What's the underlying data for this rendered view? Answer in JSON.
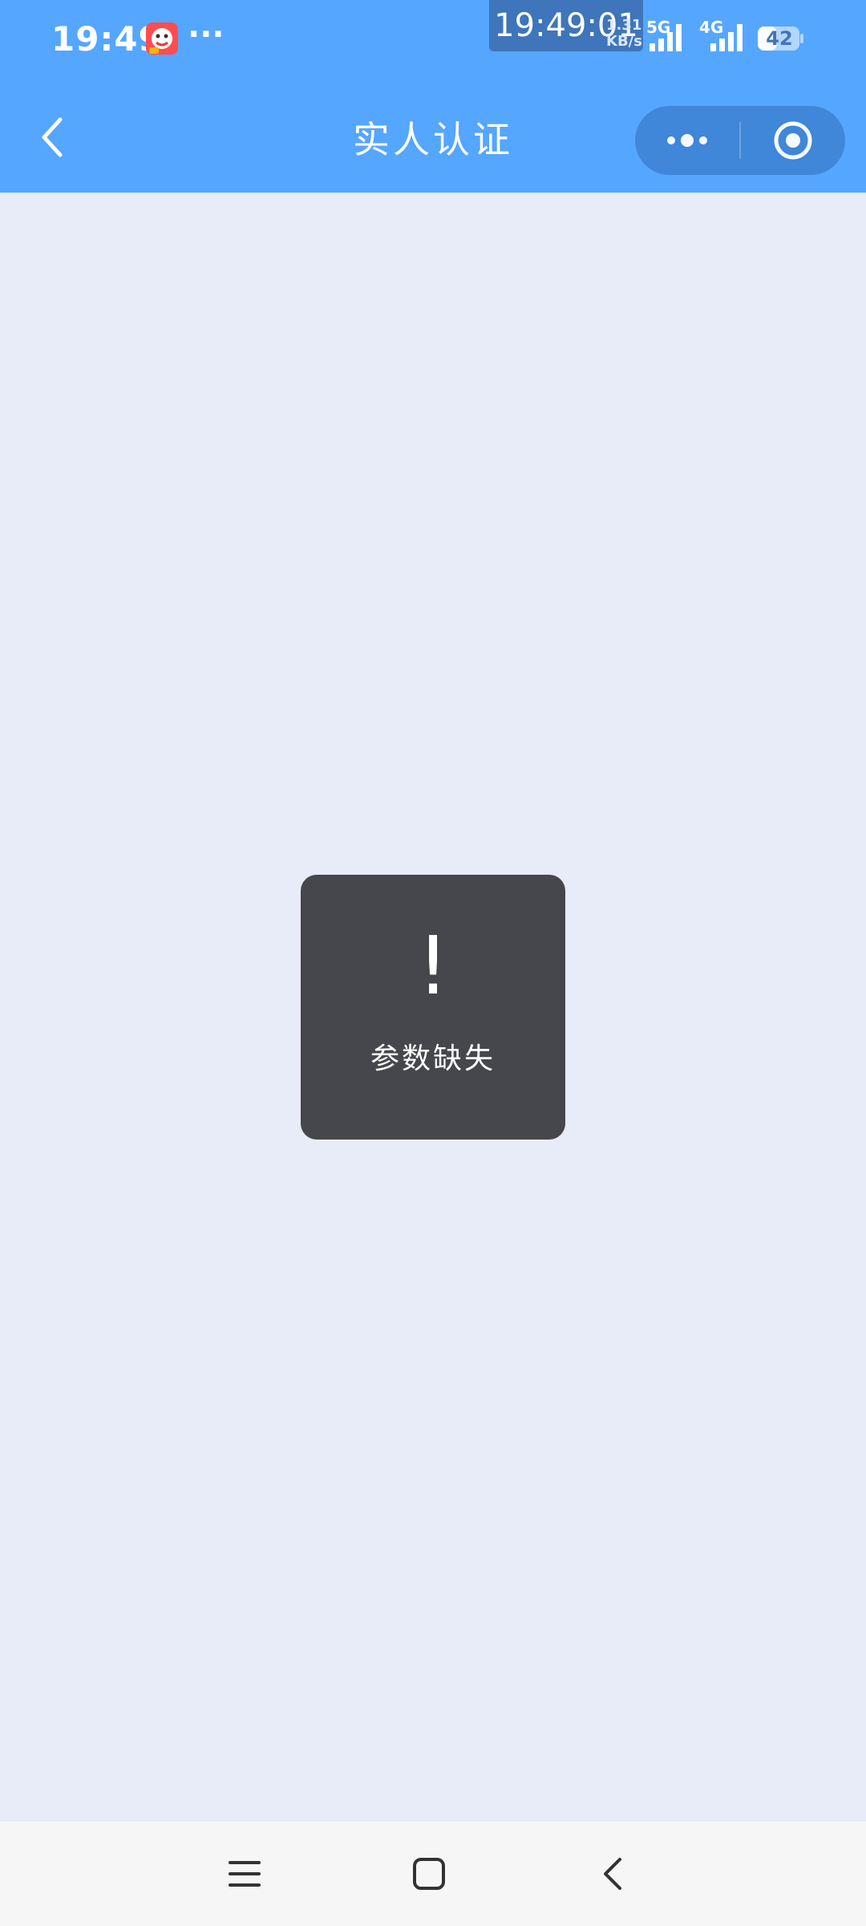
{
  "status_bar": {
    "time": "19:49",
    "app_icon": "red-mascot-icon",
    "dots": "···",
    "clock_overlay": "19:49:01",
    "speed_value": "1.31",
    "speed_unit": "KB/s",
    "network_1": "5G",
    "network_2": "4G",
    "battery_level": "42",
    "colors": {
      "background": "#55a6ff",
      "overlay": "#3f75ba"
    }
  },
  "nav": {
    "back_icon": "chevron-left-icon",
    "title": "实人认证",
    "more_icon": "more-dots-icon",
    "close_icon": "target-close-icon"
  },
  "toast": {
    "icon": "!",
    "message": "参数缺失"
  },
  "system_nav": {
    "menu_icon": "menu-lines-icon",
    "home_icon": "home-square-icon",
    "back_icon": "back-chevron-icon"
  },
  "theme": {
    "page_background": "#e7ecf8",
    "toast_background": "#46474c"
  }
}
